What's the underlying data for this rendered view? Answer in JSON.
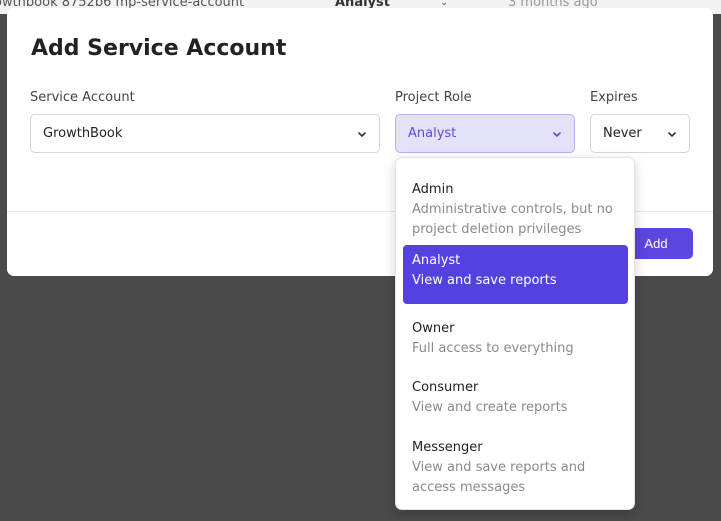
{
  "background": {
    "row_text_1": "owthbook 8752b6 mp-service-account",
    "row_role": "Analyst",
    "row_time": "3 months ago"
  },
  "modal": {
    "title": "Add Service Account",
    "service_account": {
      "label": "Service Account",
      "value": "GrowthBook"
    },
    "project_role": {
      "label": "Project Role",
      "value": "Analyst"
    },
    "expires": {
      "label": "Expires",
      "value": "Never"
    },
    "add_label": "Add"
  },
  "dropdown": {
    "options": [
      {
        "title": "Admin",
        "desc": "Administrative controls, but no project deletion privileges",
        "selected": false
      },
      {
        "title": "Analyst",
        "desc": "View and save reports",
        "selected": true
      },
      {
        "title": "Owner",
        "desc": "Full access to everything",
        "selected": false
      },
      {
        "title": "Consumer",
        "desc": "View and create reports",
        "selected": false
      },
      {
        "title": "Messenger",
        "desc": "View and save reports and access messages",
        "selected": false
      }
    ]
  },
  "colors": {
    "accent": "#5b46e0",
    "overlay": "#4a4a4a",
    "selected_option": "#5540e2",
    "active_select_bg": "#e4e1fb"
  },
  "icons": [
    "chevron-down-icon"
  ]
}
